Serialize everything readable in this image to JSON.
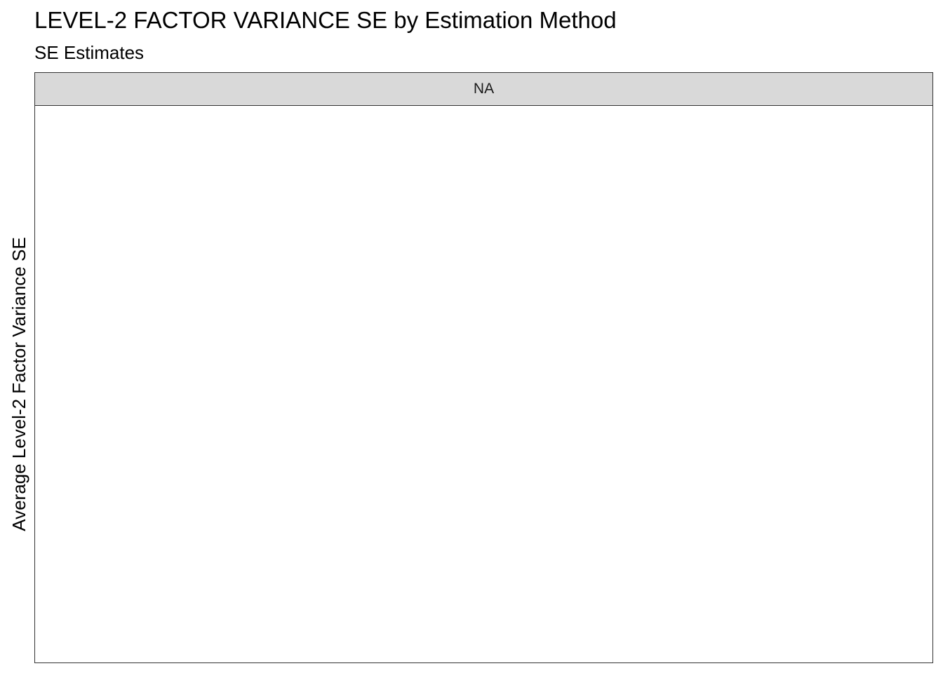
{
  "chart_data": {
    "type": "bar",
    "title": "LEVEL-2 FACTOR VARIANCE SE by Estimation Method",
    "subtitle": "SE Estimates",
    "ylabel": "Average Level-2 Factor Variance SE",
    "xlabel": "",
    "facets": [
      {
        "label": "NA",
        "series": []
      }
    ],
    "grid": false,
    "legend": "none"
  }
}
